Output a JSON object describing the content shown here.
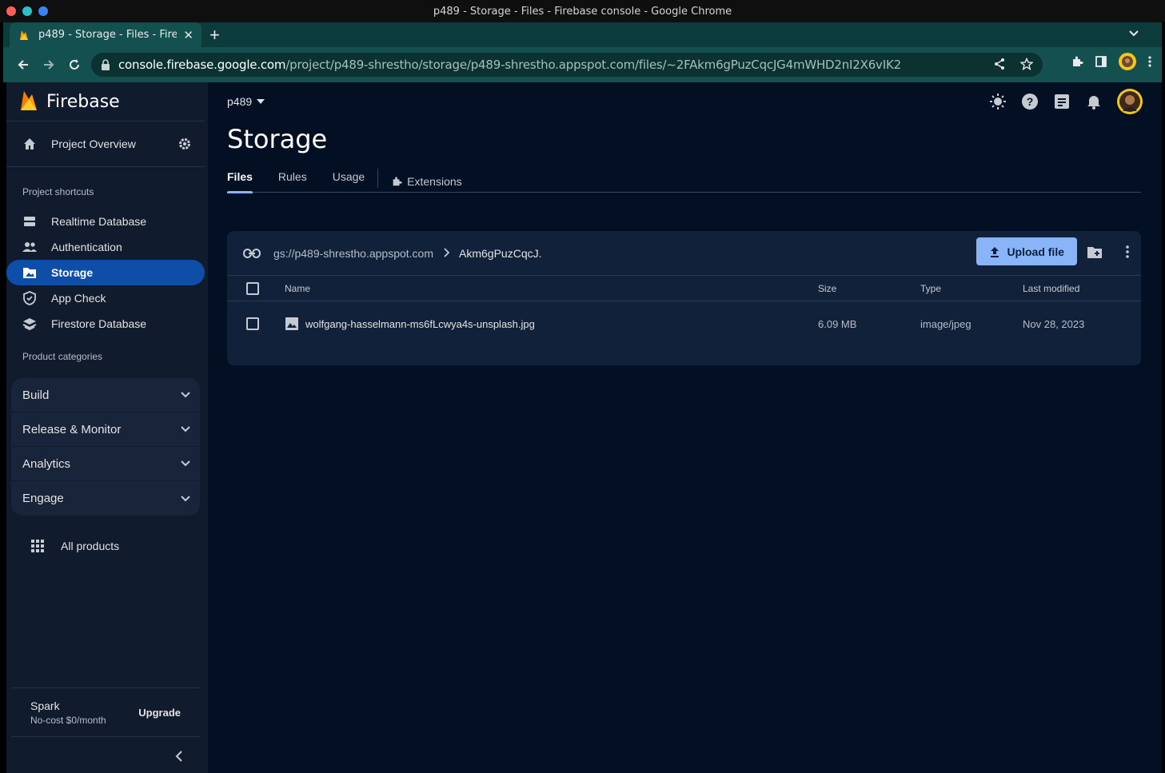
{
  "window": {
    "title": "p489 - Storage - Files - Firebase console - Google Chrome"
  },
  "browser": {
    "tab_title": "p489 - Storage - Files - Fireb",
    "url_host": "console.firebase.google.com",
    "url_path": "/project/p489-shrestho/storage/p489-shrestho.appspot.com/files/~2FAkm6gPuzCqcJG4mWHD2nI2X6vIK2"
  },
  "sidebar": {
    "brand": "Firebase",
    "overview": "Project Overview",
    "shortcuts_label": "Project shortcuts",
    "shortcuts": [
      {
        "label": "Realtime Database",
        "icon": "database-icon"
      },
      {
        "label": "Authentication",
        "icon": "people-icon"
      },
      {
        "label": "Storage",
        "icon": "image-icon"
      },
      {
        "label": "App Check",
        "icon": "shield-icon"
      },
      {
        "label": "Firestore Database",
        "icon": "firestore-icon"
      }
    ],
    "categories_label": "Product categories",
    "categories": [
      "Build",
      "Release & Monitor",
      "Analytics",
      "Engage"
    ],
    "all_products": "All products",
    "plan": {
      "name": "Spark",
      "sub": "No-cost $0/month",
      "upgrade": "Upgrade"
    }
  },
  "main": {
    "project": "p489",
    "title": "Storage",
    "tabs": [
      "Files",
      "Rules",
      "Usage",
      "Extensions"
    ],
    "bucket": "gs://p489-shrestho.appspot.com",
    "folder": "Akm6gPuzCqcJ.",
    "upload_label": "Upload file",
    "columns": {
      "name": "Name",
      "size": "Size",
      "type": "Type",
      "modified": "Last modified"
    },
    "files": [
      {
        "name": "wolfgang-hasselmann-ms6fLcwya4s-unsplash.jpg",
        "size": "6.09 MB",
        "type": "image/jpeg",
        "modified": "Nov 28, 2023"
      }
    ]
  },
  "colors": {
    "accent": "#8ab4f8",
    "active_nav": "#0f4ea8",
    "firebase_orange": "#ffa000"
  }
}
